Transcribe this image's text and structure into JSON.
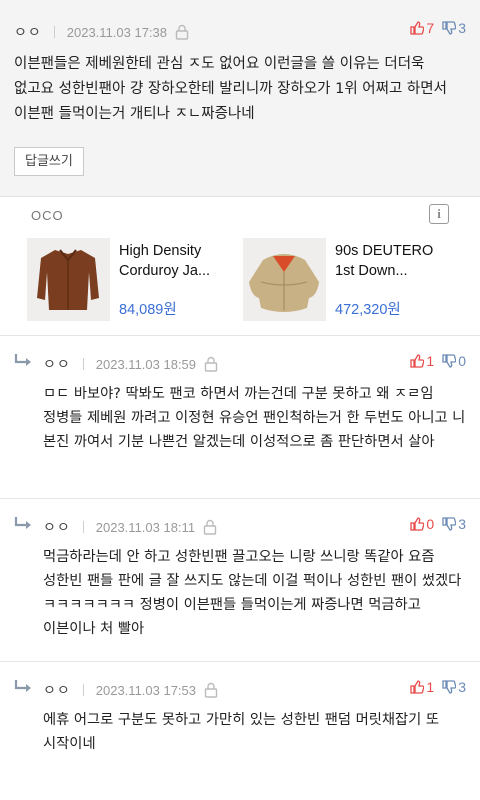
{
  "main_comment": {
    "nickname": "ㅇㅇ",
    "date": "2023.11.03 17:38",
    "upvotes": "7",
    "downvotes": "3",
    "text": "이븐팬들은 제베원한테 관심 ㅈ도 없어요 이런글을 쓸 이유는 더더욱 없고요 성한빈팬아 걍 장하오한테 발리니까 장하오가 1위 어쩌고 하면서 이븐팬 들먹이는거 개티나 ㅈㄴ짜증나네",
    "reply_button": "답글쓰기"
  },
  "ad": {
    "label": "OCO",
    "info_icon": "i",
    "products": [
      {
        "name": "High Density Corduroy Ja...",
        "price": "84,089원",
        "color": "#7a3d1f"
      },
      {
        "name": "90s DEUTERO 1st Down...",
        "price": "472,320원",
        "color": "#c8b184"
      }
    ]
  },
  "replies": [
    {
      "nickname": "ㅇㅇ",
      "date": "2023.11.03 18:59",
      "upvotes": "1",
      "downvotes": "0",
      "text": "ㅁㄷ 바보야? 딱봐도 팬코 하면서 까는건데 구분 못하고 왜 ㅈㄹ임 정병들 제베원 까려고 이정현 유승언 팬인척하는거 한 두번도 아니고 니 본진 까여서 기분 나쁜건 알겠는데 이성적으로 좀 판단하면서 살아"
    },
    {
      "nickname": "ㅇㅇ",
      "date": "2023.11.03 18:11",
      "upvotes": "0",
      "downvotes": "3",
      "text": "먹금하라는데 안 하고 성한빈팬 끌고오는 니랑 쓰니랑 똑같아 요즘 성한빈 팬들 판에 글 잘 쓰지도 않는데 이걸 퍽이나 성한빈 팬이 썼겠다 ㅋㅋㅋㅋㅋㅋㅋ 정병이 이븐팬들 들먹이는게 짜증나면 먹금하고 이븐이나 처 빨아"
    },
    {
      "nickname": "ㅇㅇ",
      "date": "2023.11.03 17:53",
      "upvotes": "1",
      "downvotes": "3",
      "text": "에휴 어그로 구분도 못하고 가만히 있는 성한빈 팬덤 머릿채잡기 또 시작이네"
    }
  ],
  "colors": {
    "upvote": "#e84a4a",
    "downvote": "#6b8ab5",
    "price": "#3b6fd6",
    "main_bg": "#f4f4f4"
  }
}
